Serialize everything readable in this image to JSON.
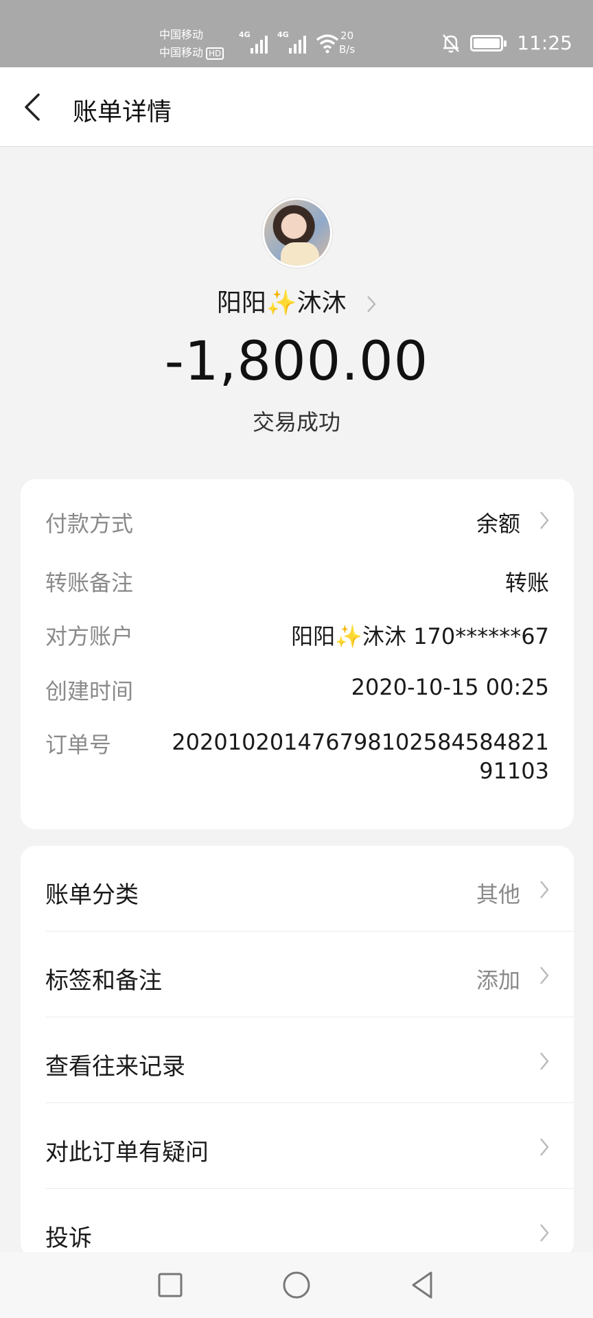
{
  "status_bar": {
    "carrier_1": "中国移动",
    "carrier_2": "中国移动",
    "hd": "HD",
    "net_1": "4G",
    "net_2": "4G",
    "speed_value": "20",
    "speed_unit": "B/s",
    "time": "11:25"
  },
  "header": {
    "title": "账单详情"
  },
  "payee": {
    "name": "阳阳✨沐沐",
    "amount": "-1,800.00",
    "status": "交易成功"
  },
  "details": [
    {
      "key": "付款方式",
      "value": "余额"
    },
    {
      "key": "转账备注",
      "value": "转账"
    },
    {
      "key": "对方账户",
      "value": "阳阳✨沐沐 170******67"
    },
    {
      "key": "创建时间",
      "value": "2020-10-15 00:25"
    },
    {
      "key": "订单号",
      "value": "20201020147679810258458482191103"
    }
  ],
  "actions": [
    {
      "label": "账单分类",
      "value": "其他"
    },
    {
      "label": "标签和备注",
      "value": "添加"
    },
    {
      "label": "查看往来记录",
      "value": ""
    },
    {
      "label": "对此订单有疑问",
      "value": ""
    },
    {
      "label": "投诉",
      "value": ""
    }
  ],
  "colors": {
    "background": "#f3f3f3",
    "status_bar": "#a9a9a9",
    "card": "#ffffff",
    "secondary_text": "#8a8a8a"
  }
}
